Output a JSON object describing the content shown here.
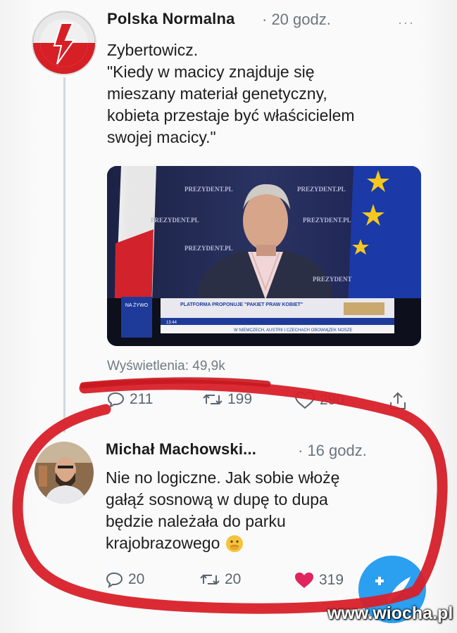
{
  "tweet1": {
    "author": "Polska Normalna",
    "time": "· 20 godz.",
    "more": "···",
    "text_lines": [
      "Zybertowicz.",
      "\"Kiedy w macicy znajduje się",
      "mieszany materiał genetyczny,",
      "kobieta przestaje być właścicielem",
      "swojej macicy.\""
    ],
    "media": {
      "wall_text": [
        "PREZYDENT.PL",
        "PREZYDENT.PL",
        "PREZYDENT.PL",
        "PREZYDENT.PL",
        "PREZYDENT.PL",
        "PREZYDENT"
      ],
      "ticker_title": "PLATFORMA PROPONUJE \"PAKIET PRAW KOBIET\"",
      "ticker_sub": "W NIEMCZECH, AUSTRII I CZECHACH OBOWIĄZEK NOSZE",
      "channel_badge": "NA ŻYWO",
      "ticker_clock": "13:44"
    },
    "views": "Wyświetlenia: 49,9k",
    "actions": {
      "replies": "211",
      "retweets": "199",
      "likes": "290"
    }
  },
  "tweet2": {
    "author": "Michał Machowski...",
    "time": "· 16 godz.",
    "text_lines": [
      "Nie no logiczne. Jak sobie włożę",
      "gałąź sosnową w dupę to dupa",
      "będzie należała do parku",
      "krajobrazowego"
    ],
    "emoji": "face-with-hand-over-mouth",
    "actions": {
      "replies": "20",
      "retweets": "20",
      "likes": "319"
    }
  },
  "colors": {
    "accent": "#1d9bf0",
    "like_red": "#e0245e",
    "marker_red": "#d8202a"
  },
  "watermark": "www.wiocha.pl"
}
